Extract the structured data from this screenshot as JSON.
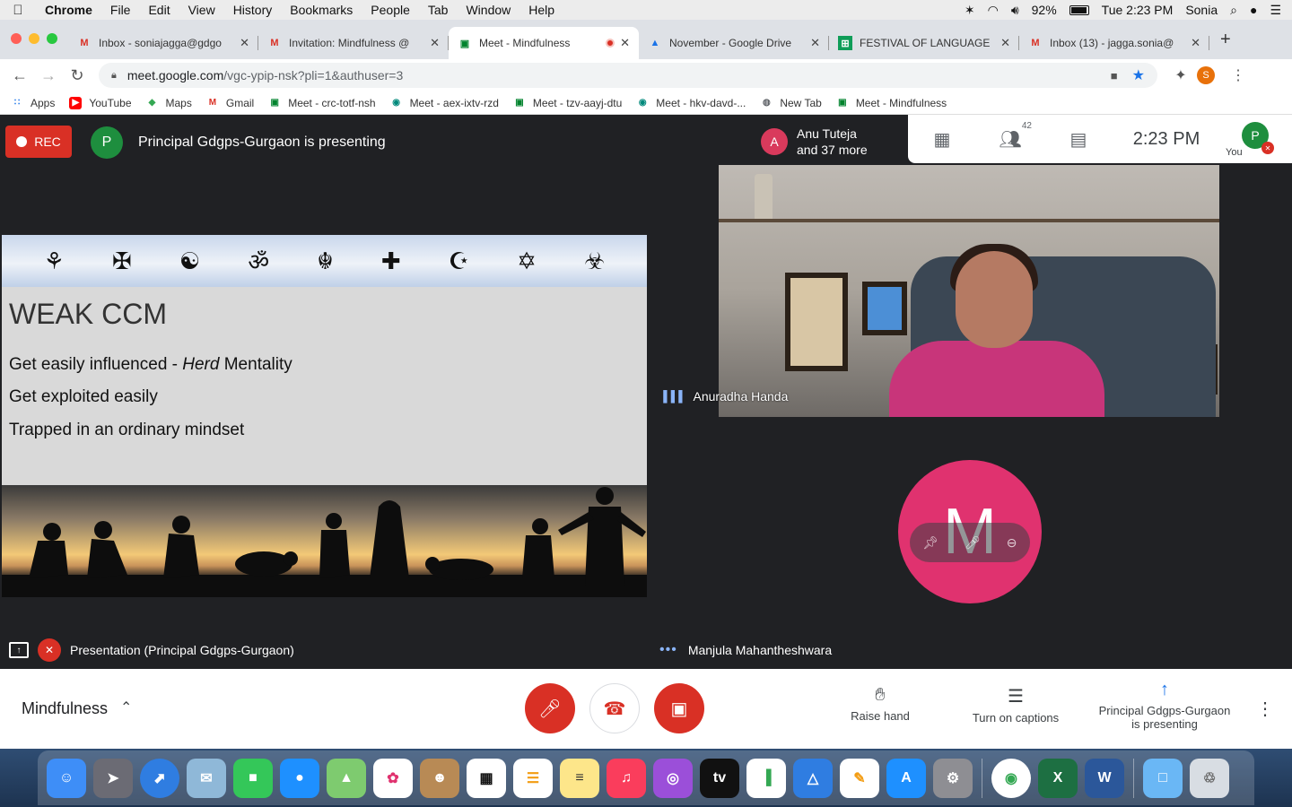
{
  "menubar": {
    "items": [
      "Chrome",
      "File",
      "Edit",
      "View",
      "History",
      "Bookmarks",
      "People",
      "Tab",
      "Window",
      "Help"
    ],
    "battery": "92%",
    "datetime": "Tue 2:23 PM",
    "user": "Sonia"
  },
  "tabs": [
    {
      "title": "Inbox - soniajagga@gdgo",
      "icon": "gmail-icon"
    },
    {
      "title": "Invitation: Mindfulness @",
      "icon": "gmail-icon"
    },
    {
      "title": "Meet - Mindfulness",
      "icon": "meet-icon",
      "active": true
    },
    {
      "title": "November - Google Drive",
      "icon": "drive-icon"
    },
    {
      "title": "FESTIVAL OF LANGUAGE",
      "icon": "sheets-icon"
    },
    {
      "title": "Inbox (13) - jagga.sonia@",
      "icon": "gmail-icon"
    }
  ],
  "address": {
    "host": "meet.google.com",
    "path": "/vgc-ypip-nsk?pli=1&authuser=3",
    "profile_initial": "S"
  },
  "bookmarks": [
    {
      "label": "Apps",
      "icon": "apps-grid-icon"
    },
    {
      "label": "YouTube",
      "icon": "youtube-icon"
    },
    {
      "label": "Maps",
      "icon": "maps-icon"
    },
    {
      "label": "Gmail",
      "icon": "gmail-icon"
    },
    {
      "label": "Meet - crc-totf-nsh",
      "icon": "meet-icon"
    },
    {
      "label": "Meet - aex-ixtv-rzd",
      "icon": "meet-old-icon"
    },
    {
      "label": "Meet - tzv-aayj-dtu",
      "icon": "meet-icon"
    },
    {
      "label": "Meet - hkv-davd-...",
      "icon": "meet-old-icon"
    },
    {
      "label": "New Tab",
      "icon": "globe-icon"
    },
    {
      "label": "Meet - Mindfulness",
      "icon": "meet-icon"
    }
  ],
  "meet": {
    "rec_label": "REC",
    "presenter_initial": "P",
    "presenting_text": "Principal Gdgps-Gurgaon is presenting",
    "people_chip": {
      "initial": "A",
      "line1": "Anu Tuteja",
      "line2": "and 37 more"
    },
    "participant_count": "42",
    "clock": "2:23 PM",
    "you_initial": "P",
    "you_label": "You",
    "slide": {
      "title": "WEAK CCM",
      "line1_a": "Get easily influenced - ",
      "line1_b": "Herd",
      "line1_c": " Mentality",
      "line2": "Get exploited easily",
      "line3": "Trapped in an ordinary mindset"
    },
    "presentation_label": "Presentation (Principal Gdgps-Gurgaon)",
    "tile1_name": "Anuradha Handa",
    "tile2_initial": "M",
    "tile2_name": "Manjula Mahantheshwara"
  },
  "bottom": {
    "meeting_title": "Mindfulness",
    "raise_hand": "Raise hand",
    "captions": "Turn on captions",
    "presenting_line1": "Principal Gdgps-Gurgaon",
    "presenting_line2": "is presenting"
  },
  "colors": {
    "rec": "#d93025",
    "meet_bg": "#202124",
    "avatar_m": "#e0326f",
    "avatar_a": "#d93a5c",
    "avatar_p": "#1e8e3e"
  }
}
